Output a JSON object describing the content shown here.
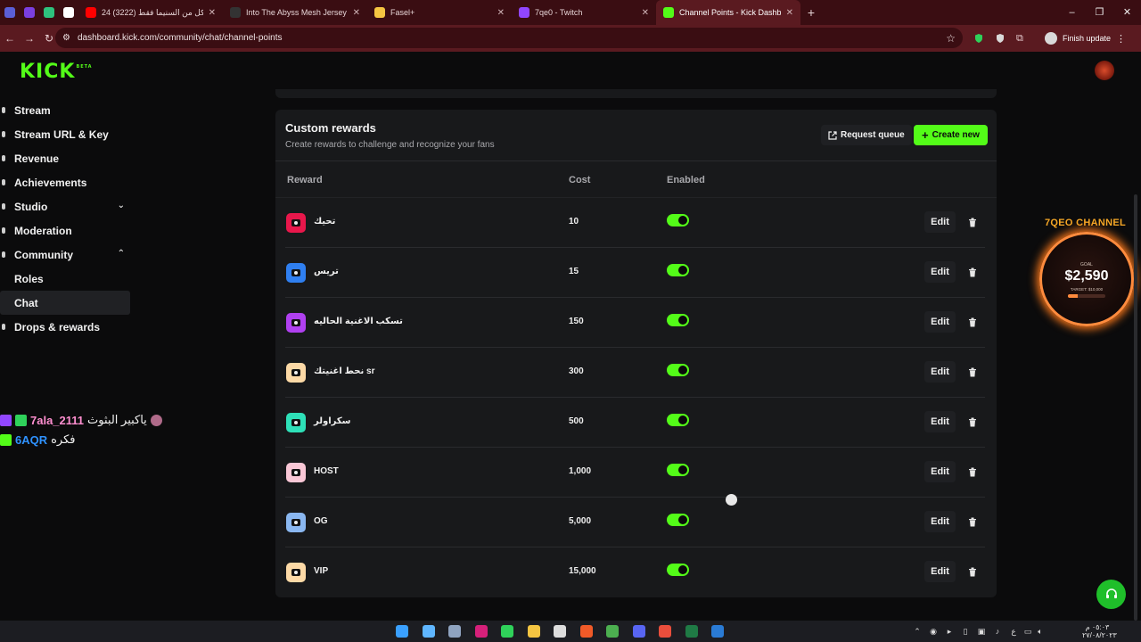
{
  "browser": {
    "tabs": [
      {
        "label": "",
        "favicon_color": "#5b5fd6",
        "small": true
      },
      {
        "label": "",
        "favicon_color": "#7b3fe0",
        "small": true
      },
      {
        "label": "",
        "favicon_color": "#2ec27e",
        "small": true
      },
      {
        "label": "",
        "favicon_color": "#ffffff",
        "small": true
      },
      {
        "label": "24 ساعة اكل من السنيما فقط (3222)",
        "favicon_color": "#ff0000"
      },
      {
        "label": "Into The Abyss Mesh Jersey – n",
        "favicon_color": "#333333"
      },
      {
        "label": "Fasel+",
        "favicon_color": "#f5c542"
      },
      {
        "label": "7qe0 - Twitch",
        "favicon_color": "#9146ff"
      },
      {
        "label": "Channel Points - Kick Dashboard",
        "favicon_color": "#53fc18",
        "active": true
      }
    ],
    "new_tab": "+",
    "window_controls": [
      "–",
      "❐",
      "✕"
    ],
    "url": "dashboard.kick.com/community/chat/channel-points",
    "finish_update": "Finish update"
  },
  "brand": {
    "logo": "KICK",
    "logo_badge": "BETA",
    "accent": "#53fc18"
  },
  "sidebar": {
    "items": [
      {
        "label": "Stream",
        "chev": ""
      },
      {
        "label": "Stream URL & Key",
        "chev": ""
      },
      {
        "label": "Revenue",
        "chev": ""
      },
      {
        "label": "Achievements",
        "chev": ""
      },
      {
        "label": "Studio",
        "chev": "⌄"
      },
      {
        "label": "Moderation",
        "chev": ""
      },
      {
        "label": "Community",
        "chev": "⌃"
      },
      {
        "label": "Roles",
        "chev": ""
      },
      {
        "label": "Chat",
        "chev": "",
        "active": true
      },
      {
        "label": "Drops & rewards",
        "chev": ""
      }
    ]
  },
  "chat_overlay": [
    {
      "name": "7ala_2111",
      "message": "ياكبير البثوث",
      "name_color": "#ff8fd0"
    },
    {
      "name": "6AQR",
      "message": "فكره",
      "name_color": "#2f92ff"
    }
  ],
  "rewards_panel": {
    "title": "Custom rewards",
    "subtitle": "Create rewards to challenge and recognize your fans",
    "request_queue_label": "Request queue",
    "create_new_label": "Create new",
    "columns": {
      "reward": "Reward",
      "cost": "Cost",
      "enabled": "Enabled"
    },
    "edit_label": "Edit",
    "rows": [
      {
        "name": "تحيك",
        "cost": "10",
        "enabled": true,
        "color": "#e8174b"
      },
      {
        "name": "تريس",
        "cost": "15",
        "enabled": true,
        "color": "#2f7ff0"
      },
      {
        "name": "تسكب الاغنية الحاليه",
        "cost": "150",
        "enabled": true,
        "color": "#b040f0"
      },
      {
        "name": "نحط اغنيتك sr",
        "cost": "300",
        "enabled": true,
        "color": "#fcd9a6"
      },
      {
        "name": "سكراولر",
        "cost": "500",
        "enabled": true,
        "color": "#2ee0b8"
      },
      {
        "name": "HOST",
        "cost": "1,000",
        "enabled": true,
        "color": "#f9c7d6"
      },
      {
        "name": "OG",
        "cost": "5,000",
        "enabled": true,
        "color": "#8ab7f0"
      },
      {
        "name": "VIP",
        "cost": "15,000",
        "enabled": true,
        "color": "#fcd9a6"
      }
    ]
  },
  "goal_widget": {
    "title": "7QEO CHANNEL",
    "goal_label": "GOAL",
    "amount": "$2,590",
    "target": "TARGET: $10,000",
    "progress": 0.259,
    "accent": "#ff8b3d"
  },
  "taskbar": {
    "icons": [
      {
        "name": "windows-icon",
        "color": "#3aa0ff"
      },
      {
        "name": "search-icon",
        "color": "#5fb6ff"
      },
      {
        "name": "settings-icon",
        "color": "#8fa3c0"
      },
      {
        "name": "app-icon-pink",
        "color": "#d6207a"
      },
      {
        "name": "app-icon-green",
        "color": "#2fd15a"
      },
      {
        "name": "file-explorer-icon",
        "color": "#f5c542"
      },
      {
        "name": "obs-icon",
        "color": "#dddddd"
      },
      {
        "name": "brave-icon",
        "color": "#f05a28"
      },
      {
        "name": "chrome-icon",
        "color": "#4caf50"
      },
      {
        "name": "discord-icon",
        "color": "#5865f2"
      },
      {
        "name": "app-icon-multi",
        "color": "#e94e3c"
      },
      {
        "name": "excel-icon",
        "color": "#1f7a45"
      },
      {
        "name": "steam-icon",
        "color": "#2a7bd5"
      }
    ],
    "tray_lang": "ع",
    "clock_time": "٠٥:٠٣ م",
    "clock_date": "٢٧/٠٨/٢٠٢٣"
  }
}
